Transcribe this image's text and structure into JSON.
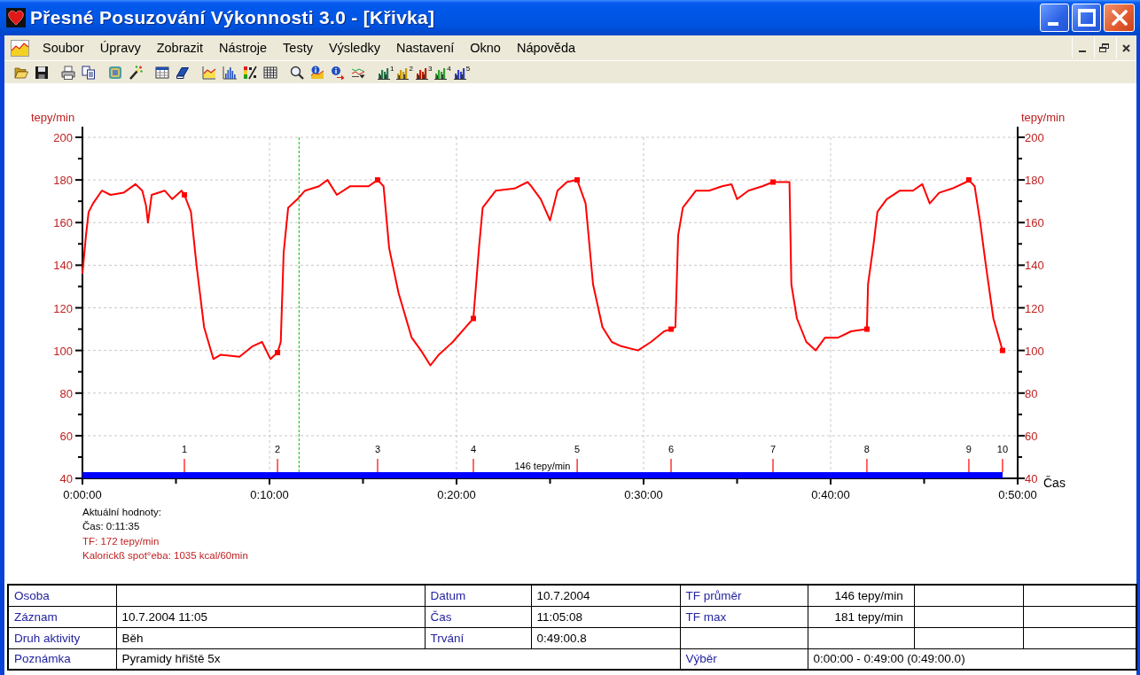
{
  "window": {
    "title": "Přesné Posuzování Výkonnosti 3.0 - [Křivka]"
  },
  "menu": [
    "Soubor",
    "Úpravy",
    "Zobrazit",
    "Nástroje",
    "Testy",
    "Výsledky",
    "Nastavení",
    "Okno",
    "Nápověda"
  ],
  "toolbar": {
    "chart_buttons": [
      {
        "label": "1",
        "color": "#287a50"
      },
      {
        "label": "2",
        "color": "#c89a00"
      },
      {
        "label": "3",
        "color": "#c02000"
      },
      {
        "label": "4",
        "color": "#30a030"
      },
      {
        "label": "5",
        "color": "#3040c0"
      }
    ]
  },
  "chart": {
    "left_axis": {
      "ticks": [
        "200",
        "180",
        "160",
        "140",
        "120",
        "100",
        "80",
        "60",
        "40"
      ]
    },
    "right_axis": {
      "label": "tepy/min",
      "ticks": [
        "200",
        "180",
        "160",
        "140",
        "120",
        "100",
        "80",
        "60",
        "40"
      ]
    },
    "selection": {
      "label": "146 tepy/min"
    },
    "chart_data": {
      "type": "line",
      "xlabel": "Čas",
      "ylabel": "tepy/min",
      "x": [
        0,
        0.19,
        0.33,
        0.57,
        1.04,
        1.5,
        2.2,
        2.84,
        3.2,
        3.4,
        3.5,
        3.7,
        4.4,
        4.8,
        5.3,
        5.45,
        5.8,
        6.1,
        6.5,
        7.0,
        7.4,
        8.4,
        9.1,
        9.6,
        10.05,
        10.43,
        10.6,
        10.76,
        11.0,
        11.5,
        11.9,
        12.65,
        13.1,
        13.6,
        14.3,
        15.3,
        15.78,
        16.1,
        16.4,
        16.9,
        17.6,
        18.1,
        18.6,
        19.05,
        19.8,
        20.5,
        20.9,
        21.2,
        21.4,
        22.1,
        23.1,
        23.8,
        24.0,
        24.5,
        25.0,
        25.4,
        25.9,
        26.45,
        26.9,
        27.3,
        27.8,
        28.3,
        28.8,
        29.7,
        30.4,
        31.1,
        31.47,
        31.7,
        31.85,
        32.1,
        32.8,
        33.5,
        34.2,
        34.7,
        35.0,
        35.6,
        36.35,
        36.92,
        37.8,
        37.9,
        38.2,
        38.7,
        39.2,
        39.7,
        40.4,
        41.1,
        41.94,
        42.0,
        42.3,
        42.5,
        43.0,
        43.7,
        44.4,
        44.9,
        45.3,
        45.8,
        46.5,
        47.25,
        47.39,
        47.7,
        48.0,
        48.3,
        48.7,
        49.19
      ],
      "series": [
        {
          "color": "#ff0000",
          "values": [
            136,
            154,
            165,
            169,
            175,
            173,
            174,
            178,
            175,
            168,
            160,
            173,
            175,
            171,
            175,
            173,
            165,
            140,
            111,
            96,
            98,
            97,
            102,
            104,
            96,
            99,
            104,
            146,
            167,
            171,
            175,
            177,
            180,
            173,
            177,
            177,
            180,
            177,
            148,
            127,
            106,
            100,
            93,
            98,
            104,
            111,
            115,
            148,
            167,
            175,
            176,
            179,
            177,
            171,
            161,
            175,
            179,
            180,
            169,
            131,
            111,
            104,
            102,
            100,
            104,
            109,
            110,
            111,
            154,
            167,
            175,
            175,
            177,
            178,
            171,
            175,
            177,
            179,
            179,
            131,
            115,
            104,
            100,
            106,
            106,
            109,
            110,
            131,
            150,
            165,
            171,
            175,
            175,
            178,
            169,
            174,
            176,
            179,
            180,
            177,
            160,
            140,
            115,
            100
          ]
        },
        {
          "color": "#ff0000",
          "marker": "square",
          "values": [
            null,
            null,
            null,
            null,
            null,
            null,
            null,
            null,
            null,
            null,
            null,
            null,
            null,
            null,
            null,
            173,
            null,
            null,
            null,
            null,
            null,
            null,
            null,
            null,
            null,
            99,
            null,
            null,
            null,
            null,
            null,
            null,
            null,
            null,
            null,
            null,
            180,
            null,
            null,
            null,
            null,
            null,
            null,
            null,
            null,
            null,
            115,
            null,
            null,
            null,
            null,
            null,
            null,
            null,
            null,
            null,
            null,
            180,
            null,
            null,
            null,
            null,
            null,
            null,
            null,
            null,
            110,
            null,
            null,
            null,
            null,
            null,
            null,
            null,
            null,
            null,
            null,
            179,
            null,
            null,
            null,
            null,
            null,
            null,
            null,
            null,
            110,
            null,
            null,
            null,
            null,
            null,
            null,
            null,
            null,
            null,
            null,
            null,
            180,
            null,
            null,
            null,
            null,
            100
          ]
        }
      ],
      "xlim": [
        0,
        50
      ],
      "ylim": [
        40,
        200
      ],
      "grid": true,
      "xticks": [
        {
          "value": 0,
          "label": "0:00:00"
        },
        {
          "value": 10,
          "label": "0:10:00"
        },
        {
          "value": 20,
          "label": "0:20:00"
        },
        {
          "value": 30,
          "label": "0:30:00"
        },
        {
          "value": 40,
          "label": "0:40:00"
        },
        {
          "value": 50,
          "label": "0:50:00"
        }
      ],
      "yticks": [
        40,
        60,
        80,
        100,
        120,
        140,
        160,
        180,
        200
      ],
      "ref_lines": [
        {
          "axis": "x",
          "value": 11.58,
          "color": "#00c000"
        }
      ],
      "annotations": [
        "1",
        "2",
        "3",
        "4",
        "5",
        "6",
        "7",
        "8",
        "9",
        "10"
      ]
    }
  },
  "readout": {
    "lines": [
      {
        "text": "Aktuální hodnoty:",
        "highlighted": false
      },
      {
        "text": "Čas: 0:11:35",
        "highlighted": false
      },
      {
        "text": "TF: 172 tepy/min",
        "highlighted": true
      },
      {
        "text": "Kalorickß spot°eba: 1035 kcal/60min",
        "highlighted": true
      }
    ]
  },
  "summary_table": {
    "rows": [
      {
        "cells": [
          {
            "kind": "label",
            "text": "Osoba"
          },
          {
            "kind": "value"
          },
          {
            "kind": "label",
            "text": "Datum"
          },
          {
            "kind": "value",
            "text": "10.7.2004"
          },
          {
            "kind": "label",
            "text": "TF průměr"
          },
          {
            "kind": "value",
            "text": "146 tepy/min"
          },
          {
            "kind": "value"
          },
          {
            "kind": "value"
          }
        ]
      },
      {
        "cells": [
          {
            "kind": "label",
            "text": "Záznam"
          },
          {
            "kind": "value",
            "text": "10.7.2004 11:05"
          },
          {
            "kind": "label",
            "text": "Čas"
          },
          {
            "kind": "value",
            "text": "11:05:08"
          },
          {
            "kind": "label",
            "text": "TF max"
          },
          {
            "kind": "value",
            "text": "181 tepy/min"
          },
          {
            "kind": "value"
          },
          {
            "kind": "value"
          }
        ]
      },
      {
        "cells": [
          {
            "kind": "label",
            "text": "Druh aktivity"
          },
          {
            "kind": "value",
            "text": "Běh"
          },
          {
            "kind": "label",
            "text": "Trvání"
          },
          {
            "kind": "value",
            "text": "0:49:00.8"
          },
          {
            "kind": "value"
          },
          {
            "kind": "value"
          },
          {
            "kind": "value"
          },
          {
            "kind": "value"
          }
        ]
      },
      {
        "cells": [
          {
            "kind": "label",
            "text": "Poznámka"
          },
          {
            "kind": "value",
            "text": "Pyramidy hřiště 5x",
            "colspan": 3
          },
          {
            "kind": "label",
            "text": "Výběr"
          },
          {
            "kind": "value",
            "text": "0:00:00 - 0:49:00 (0:49:00.0)",
            "colspan": 3
          }
        ]
      }
    ]
  }
}
